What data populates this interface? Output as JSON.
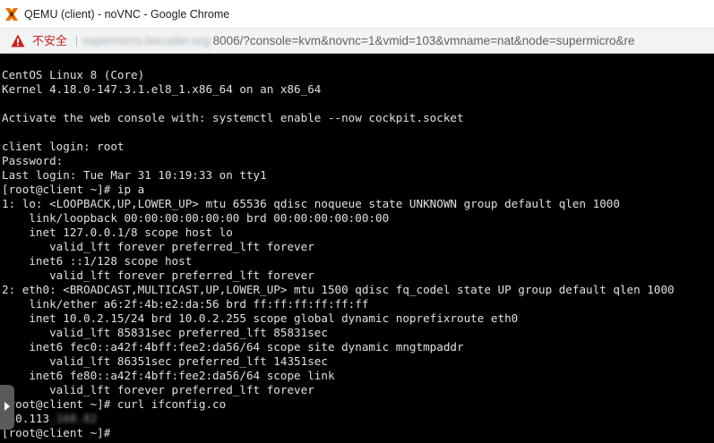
{
  "window": {
    "title": "QEMU (client) - noVNC - Google Chrome",
    "app_icon": "proxmox-x-icon"
  },
  "address_bar": {
    "security_icon": "warning-triangle-icon",
    "security_label": "不安全",
    "url_host": "supermicro.becoder.org:",
    "url_path": "8006/?console=kvm&novnc=1&vmid=103&vmname=nat&node=supermicro&re"
  },
  "terminal": {
    "lines": [
      "CentOS Linux 8 (Core)",
      "Kernel 4.18.0-147.3.1.el8_1.x86_64 on an x86_64",
      "",
      "Activate the web console with: systemctl enable --now cockpit.socket",
      "",
      "client login: root",
      "Password:",
      "Last login: Tue Mar 31 10:19:33 on tty1",
      "[root@client ~]# ip a",
      "1: lo: <LOOPBACK,UP,LOWER_UP> mtu 65536 qdisc noqueue state UNKNOWN group default qlen 1000",
      "    link/loopback 00:00:00:00:00:00 brd 00:00:00:00:00:00",
      "    inet 127.0.0.1/8 scope host lo",
      "       valid_lft forever preferred_lft forever",
      "    inet6 ::1/128 scope host",
      "       valid_lft forever preferred_lft forever",
      "2: eth0: <BROADCAST,MULTICAST,UP,LOWER_UP> mtu 1500 qdisc fq_codel state UP group default qlen 1000",
      "    link/ether a6:2f:4b:e2:da:56 brd ff:ff:ff:ff:ff:ff",
      "    inet 10.0.2.15/24 brd 10.0.2.255 scope global dynamic noprefixroute eth0",
      "       valid_lft 85831sec preferred_lft 85831sec",
      "    inet6 fec0::a42f:4bff:fee2:da56/64 scope site dynamic mngtmpaddr",
      "       valid_lft 86351sec preferred_lft 14351sec",
      "    inet6 fe80::a42f:4bff:fee2:da56/64 scope link",
      "       valid_lft forever preferred_lft forever",
      "[root@client ~]# curl ifconfig.co"
    ],
    "ip_output_visible": "140.113",
    "ip_output_blurred": ".168.82",
    "final_prompt": "[root@client ~]# "
  },
  "novnc_control_bar": {
    "handle_icon": "chevron-right-icon"
  },
  "colors": {
    "terminal_bg": "#000000",
    "terminal_fg": "#e0e0e0",
    "security_warning": "#c5221f",
    "address_bar_bg": "#f1f3f4",
    "titlebar_bg": "#ffffff",
    "novnc_handle": "#5a5a5a"
  }
}
